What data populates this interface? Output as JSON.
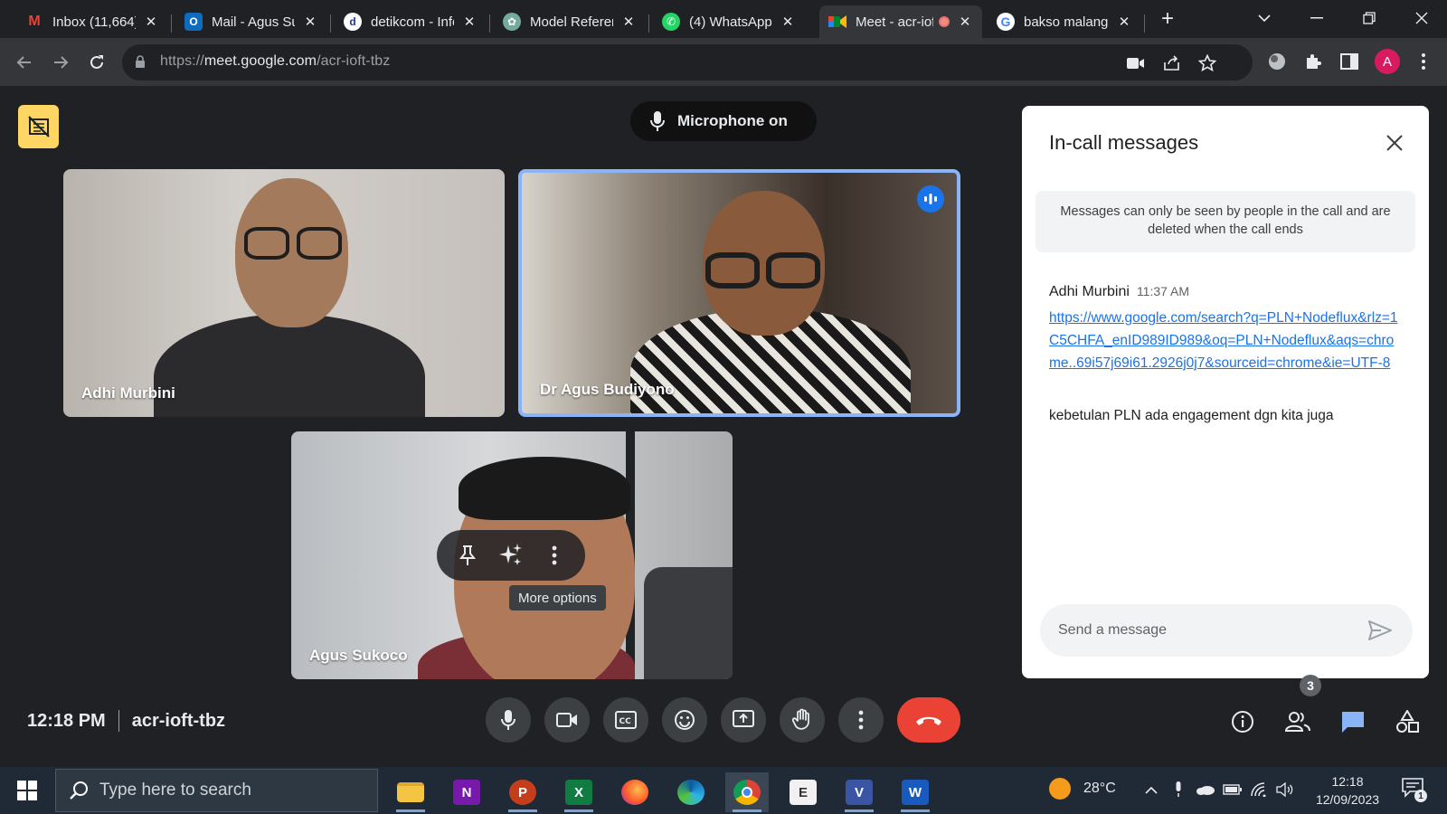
{
  "browser": {
    "tabs": [
      {
        "title": "Inbox (11,664)",
        "favicon": "gmail-icon"
      },
      {
        "title": "Mail - Agus Sukoco",
        "favicon": "outlook-icon"
      },
      {
        "title": "detikcom - Informasi",
        "favicon": "detik-icon"
      },
      {
        "title": "Model Referensi",
        "favicon": "chatgpt-icon"
      },
      {
        "title": "(4) WhatsApp",
        "favicon": "whatsapp-icon"
      },
      {
        "title": "Meet - acr-ioft-tbz",
        "favicon": "meet-icon",
        "active": true
      },
      {
        "title": "bakso malang",
        "favicon": "google-icon"
      }
    ],
    "url_prefix": "https://",
    "url_host": "meet.google.com",
    "url_path": "/acr-ioft-tbz",
    "profile_initial": "A"
  },
  "meet": {
    "mic_status": "Microphone on",
    "participants": [
      {
        "name": "Adhi Murbini"
      },
      {
        "name": "Dr Agus Budiyono",
        "speaking": true
      },
      {
        "name": "Agus Sukoco"
      }
    ],
    "tooltip": "More options",
    "clock": "12:18 PM",
    "meeting_code": "acr-ioft-tbz",
    "participant_count": "3"
  },
  "chat": {
    "title": "In-call messages",
    "notice": "Messages can only be seen by people in the call and are deleted when the call ends",
    "messages": [
      {
        "sender": "Adhi Murbini",
        "time": "11:37 AM",
        "link": "https://www.google.com/search?q=PLN+Nodeflux&rlz=1C5CHFA_enID989ID989&oq=PLN+Nodeflux&aqs=chrome..69i57j69i61.2926j0j7&sourceid=chrome&ie=UTF-8",
        "text": "kebetulan PLN ada engagement dgn kita juga"
      }
    ],
    "input_placeholder": "Send a message"
  },
  "taskbar": {
    "search_placeholder": "Type here to search",
    "temperature": "28°C",
    "time": "12:18",
    "date": "12/09/2023",
    "notification_count": "1"
  },
  "colors": {
    "accent": "#1a73e8",
    "end_call": "#ea4335",
    "speaking_border": "#8ab4f8",
    "host_badge": "#fdd663"
  }
}
